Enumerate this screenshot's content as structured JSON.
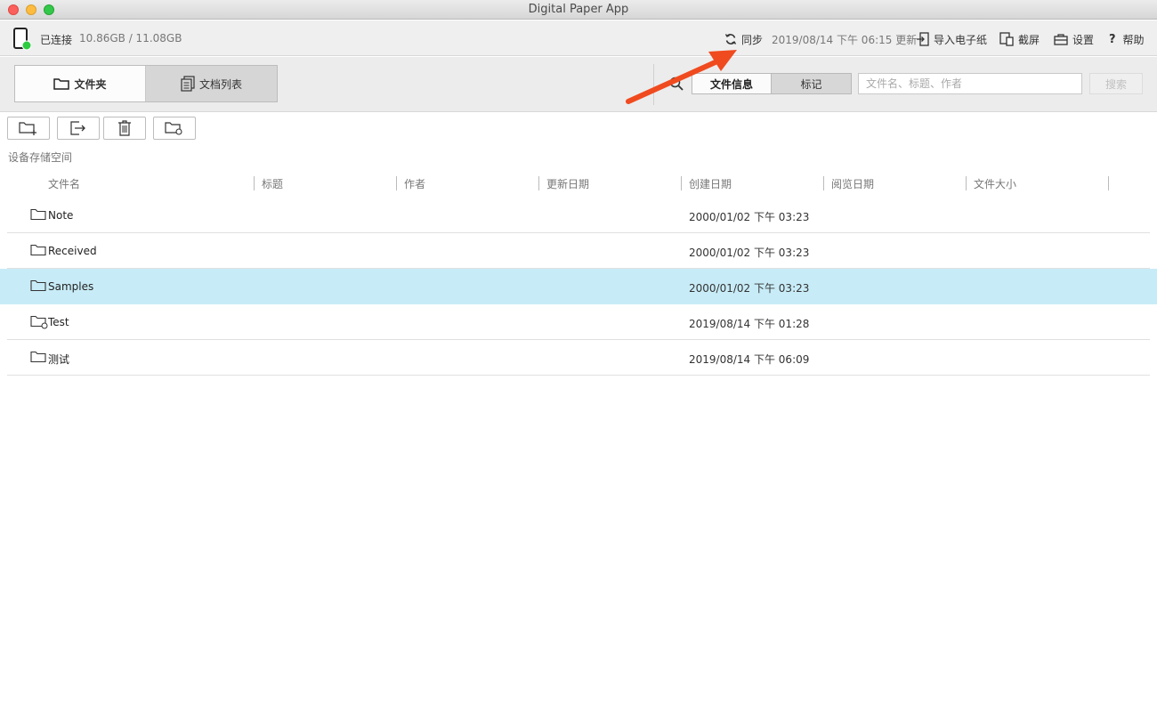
{
  "window": {
    "title": "Digital Paper App"
  },
  "status": {
    "connection": "已连接",
    "storage": "10.86GB / 11.08GB",
    "sync_label": "同步",
    "sync_time": "2019/08/14 下午 06:15 更新",
    "import_label": "导入电子纸",
    "capture_label": "截屏",
    "settings_label": "设置",
    "help_label": "帮助"
  },
  "tabs": {
    "folder": "文件夹",
    "doclist": "文档列表"
  },
  "search": {
    "segment_info": "文件信息",
    "segment_marks": "标记",
    "placeholder": "文件名、标题、作者",
    "button": "搜索"
  },
  "location": "设备存储空间",
  "columns": [
    "文件名",
    "标题",
    "作者",
    "更新日期",
    "创建日期",
    "阅览日期",
    "文件大小"
  ],
  "rows": [
    {
      "name": "Note",
      "created": "2000/01/02 下午 03:23",
      "selected": false,
      "synced": false
    },
    {
      "name": "Received",
      "created": "2000/01/02 下午 03:23",
      "selected": false,
      "synced": false
    },
    {
      "name": "Samples",
      "created": "2000/01/02 下午 03:23",
      "selected": true,
      "synced": false
    },
    {
      "name": "Test",
      "created": "2019/08/14 下午 01:28",
      "selected": false,
      "synced": true
    },
    {
      "name": "测试",
      "created": "2019/08/14 下午 06:09",
      "selected": false,
      "synced": false
    }
  ],
  "colors": {
    "selected_row": "#c8ecf7",
    "arrow": "#f04a1f",
    "connected_dot": "#2ecc40"
  }
}
